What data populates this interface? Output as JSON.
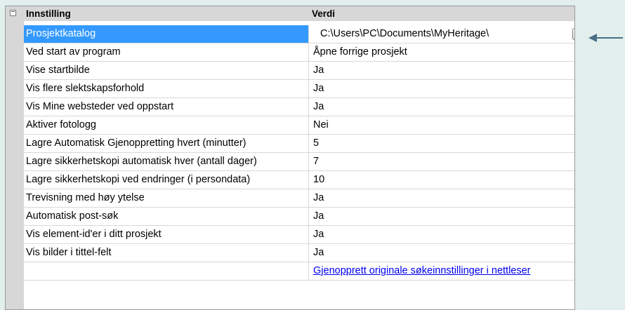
{
  "header": {
    "setting_label": "Innstilling",
    "value_label": "Verdi"
  },
  "rows": [
    {
      "name": "Prosjektkatalog",
      "value": "C:\\Users\\PC\\Documents\\MyHeritage\\"
    },
    {
      "name": "Ved start av program",
      "value": "Åpne forrige prosjekt"
    },
    {
      "name": "Vise startbilde",
      "value": "Ja"
    },
    {
      "name": "Vis flere slektskapsforhold",
      "value": "Ja"
    },
    {
      "name": "Vis Mine websteder ved oppstart",
      "value": "Ja"
    },
    {
      "name": "Aktiver fotologg",
      "value": "Nei"
    },
    {
      "name": "Lagre Automatisk Gjenoppretting hvert (minutter)",
      "value": "5"
    },
    {
      "name": "Lagre sikkerhetskopi automatisk hver (antall dager)",
      "value": "7"
    },
    {
      "name": "Lagre sikkerhetskopi ved endringer (i persondata)",
      "value": "10"
    },
    {
      "name": "Trevisning med høy ytelse",
      "value": "Ja"
    },
    {
      "name": "Automatisk post-søk",
      "value": "Ja"
    },
    {
      "name": "Vis element-id'er i ditt prosjekt",
      "value": "Ja"
    },
    {
      "name": "Vis bilder i tittel-felt",
      "value": "Ja"
    }
  ],
  "browse_button_label": "...",
  "restore_link": "Gjenopprett originale søkeinnstillinger i nettleser",
  "selected_row_color": "#3399ff",
  "arrow_color": "#4a6f86"
}
